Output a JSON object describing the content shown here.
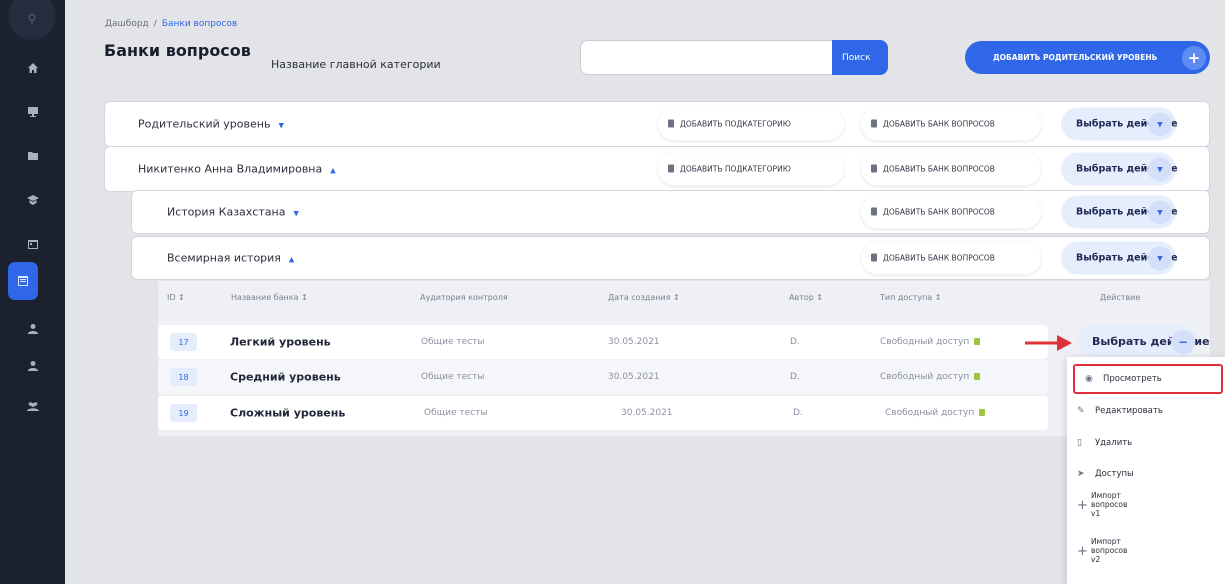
{
  "breadcrumb": {
    "home": "Дашборд",
    "separator": "/",
    "current": "Банки вопросов"
  },
  "page_title": "Банки вопросов",
  "search": {
    "label": "Название главной категории",
    "placeholder": "",
    "button": "Поиск"
  },
  "add_parent_button": "ДОБАВИТЬ РОДИТЕЛЬСКИЙ УРОВЕНЬ",
  "sidebar": {
    "icons": [
      "search-icon",
      "home-icon",
      "monitor-icon",
      "folder-icon",
      "graduation-cap-icon",
      "calendar-icon",
      "question-bank-icon",
      "user-icon",
      "user-icon",
      "users-icon"
    ],
    "active_index": 6
  },
  "categories": [
    {
      "name": "Родительский уровень",
      "expanded": false,
      "add_sub": "ДОБАВИТЬ ПОДКАТЕГОРИЮ",
      "add_bank": "ДОБАВИТЬ БАНК ВОПРОСОВ",
      "action": "Выбрать действие"
    },
    {
      "name": "Никитенко Анна Владимировна",
      "expanded": true,
      "add_sub": "ДОБАВИТЬ ПОДКАТЕГОРИЮ",
      "add_bank": "ДОБАВИТЬ БАНК ВОПРОСОВ",
      "action": "Выбрать действие"
    },
    {
      "name": "История Казахстана",
      "expanded": false,
      "add_bank": "ДОБАВИТЬ БАНК ВОПРОСОВ",
      "action": "Выбрать действие"
    },
    {
      "name": "Всемирная история",
      "expanded": true,
      "add_bank": "ДОБАВИТЬ БАНК ВОПРОСОВ",
      "action": "Выбрать действие"
    }
  ],
  "table": {
    "headers": {
      "id": "ID ↕",
      "name": "Название банка ↕",
      "audience": "Аудитория контроля",
      "date": "Дата создания ↕",
      "author": "Автор ↕",
      "access": "Тип доступа ↕",
      "action": "Действие"
    },
    "rows": [
      {
        "id": "17",
        "name": "Легкий уровень",
        "audience": "Общие тесты",
        "date": "30.05.2021",
        "author": "D.",
        "access": "Свободный доступ"
      },
      {
        "id": "18",
        "name": "Средний уровень",
        "audience": "Общие тесты",
        "date": "30.05.2021",
        "author": "D.",
        "access": "Свободный доступ"
      },
      {
        "id": "19",
        "name": "Сложный уровень",
        "audience": "Общие тесты",
        "date": "30.05.2021",
        "author": "D.",
        "access": "Свободный доступ"
      }
    ],
    "row_action": "Выбрать действие"
  },
  "dropdown": {
    "items": [
      "Просмотреть",
      "Редактировать",
      "Удалить",
      "Доступы"
    ],
    "import_v1": [
      "Импорт",
      "вопросов",
      "v1"
    ],
    "import_v2": [
      "Импорт",
      "вопросов",
      "v2"
    ]
  },
  "colors": {
    "accent": "#2f67e8",
    "sidebar": "#1c2130",
    "highlight": "#e0303a",
    "lock": "#9bc53d"
  }
}
